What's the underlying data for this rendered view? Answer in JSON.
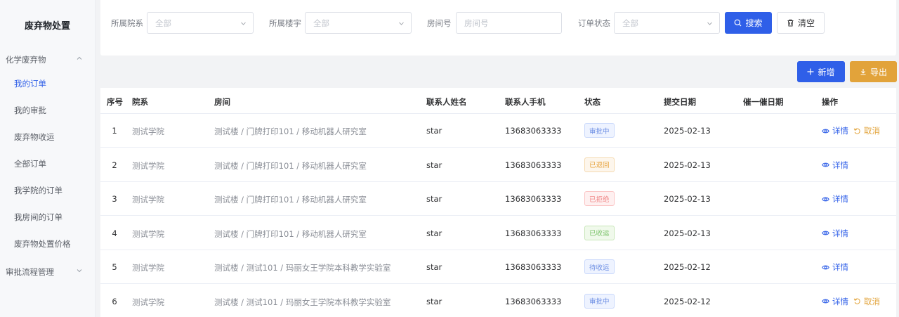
{
  "app": {
    "title": "废弃物处置"
  },
  "sidebar": {
    "group1": "化学废弃物",
    "items": [
      {
        "label": "我的订单",
        "active": true
      },
      {
        "label": "我的审批",
        "active": false
      },
      {
        "label": "废弃物收运",
        "active": false
      },
      {
        "label": "全部订单",
        "active": false
      },
      {
        "label": "我学院的订单",
        "active": false
      },
      {
        "label": "我房间的订单",
        "active": false
      },
      {
        "label": "废弃物处置价格",
        "active": false
      }
    ],
    "group2": "审批流程管理"
  },
  "filters": {
    "department_label": "所属院系",
    "department_value": "全部",
    "building_label": "所属楼宇",
    "building_value": "全部",
    "room_label": "房间号",
    "room_placeholder": "房间号",
    "status_label": "订单状态",
    "status_value": "全部",
    "search_label": "搜索",
    "clear_label": "清空"
  },
  "actions": {
    "add_label": "新增",
    "export_label": "导出"
  },
  "table": {
    "columns": [
      "序号",
      "院系",
      "房间",
      "联系人姓名",
      "联系人手机",
      "状态",
      "提交日期",
      "催一催日期",
      "操作"
    ],
    "detail_label": "详情",
    "cancel_label": "取消",
    "rows": [
      {
        "index": "1",
        "department": "测试学院",
        "room": "测试楼 / 门牌打印101 / 移动机器人研究室",
        "contact": "star",
        "phone": "13683063333",
        "status": "审批中",
        "status_type": "reviewing",
        "date": "2025-02-13",
        "remind": "",
        "can_cancel": true
      },
      {
        "index": "2",
        "department": "测试学院",
        "room": "测试楼 / 门牌打印101 / 移动机器人研究室",
        "contact": "star",
        "phone": "13683063333",
        "status": "已退回",
        "status_type": "returned",
        "date": "2025-02-13",
        "remind": "",
        "can_cancel": false
      },
      {
        "index": "3",
        "department": "测试学院",
        "room": "测试楼 / 门牌打印101 / 移动机器人研究室",
        "contact": "star",
        "phone": "13683063333",
        "status": "已拒绝",
        "status_type": "rejected",
        "date": "2025-02-13",
        "remind": "",
        "can_cancel": false
      },
      {
        "index": "4",
        "department": "测试学院",
        "room": "测试楼 / 门牌打印101 / 移动机器人研究室",
        "contact": "star",
        "phone": "13683063333",
        "status": "已收运",
        "status_type": "collected",
        "date": "2025-02-13",
        "remind": "",
        "can_cancel": false
      },
      {
        "index": "5",
        "department": "测试学院",
        "room": "测试楼 / 测试101 / 玛丽女王学院本科教学实验室",
        "contact": "star",
        "phone": "13683063333",
        "status": "待收运",
        "status_type": "pending",
        "date": "2025-02-12",
        "remind": "",
        "can_cancel": false
      },
      {
        "index": "6",
        "department": "测试学院",
        "room": "测试楼 / 测试101 / 玛丽女王学院本科教学实验室",
        "contact": "star",
        "phone": "13683063333",
        "status": "审批中",
        "status_type": "reviewing",
        "date": "2025-02-12",
        "remind": "",
        "can_cancel": true
      }
    ]
  },
  "colors": {
    "primary": "#2f5fe8",
    "warning": "#e2a33a",
    "status_reviewing": "#6b8de3",
    "status_returned": "#e6a23c",
    "status_rejected": "#f08a8a",
    "status_collected": "#7cc36b",
    "status_pending": "#6b8de3"
  }
}
